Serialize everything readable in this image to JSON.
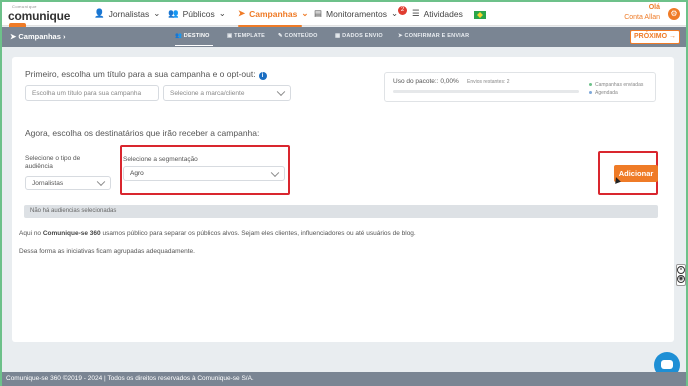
{
  "nav": {
    "logo_small": "Comunique",
    "logo_main": "comunique",
    "logo_se": "se",
    "items": [
      {
        "label": "Jornalistas",
        "icon": "users-icon"
      },
      {
        "label": "Públicos",
        "icon": "groups-icon"
      },
      {
        "label": "Campanhas",
        "icon": "send-icon"
      },
      {
        "label": "Monitoramentos",
        "icon": "monitor-icon"
      },
      {
        "label": "Atividades",
        "icon": "list-icon"
      }
    ],
    "monitor_badge": "2",
    "user_hello": "Olá",
    "user_name": "Conta Allan"
  },
  "stepbar": {
    "title": "Campanhas",
    "steps": [
      "DESTINO",
      "TEMPLATE",
      "CONTEÚDO",
      "DADOS ENVIO",
      "CONFIRMAR E ENVIAR"
    ],
    "next": "PRÓXIMO"
  },
  "form": {
    "title": "Primeiro, escolha um título para a sua campanha e o opt-out:",
    "title_placeholder": "Escolha um título para sua campanha",
    "brand_placeholder": "Selecione a marca/cliente",
    "usage_label": "Uso do pacote:: 0,00%",
    "usage_remaining": "Envios restantes: 2",
    "legend_sent": "Campanhas enviadas",
    "legend_scheduled": "Agendada",
    "section_title": "Agora, escolha os destinatários que irão receber a campanha:",
    "audience_type_label": "Selecione o tipo de audiência",
    "audience_type_value": "Jornalistas",
    "segment_label": "Selecione a segmentação",
    "segment_value": "Agro",
    "add_button": "Adicionar",
    "empty_state": "Não há audiencias selecionadas",
    "para1_prefix": "Aqui no ",
    "para1_brand": "Comunique-se 360",
    "para1_suffix": " usamos público para separar os públicos alvos. Sejam eles clientes, influenciadores ou até usuários de blog.",
    "para2": "Dessa forma as iniciativas ficam agrupadas adequadamente."
  },
  "footer": {
    "text": "Comunique-se 360 ©2019 - 2024 | Todos os direitos reservados à Comunique-se S/A."
  },
  "colors": {
    "accent": "#ef7b27",
    "highlight": "#d9262e",
    "bar": "#7a8593",
    "legend_sent": "#6dc18a",
    "legend_scheduled": "#7fa8d9"
  }
}
